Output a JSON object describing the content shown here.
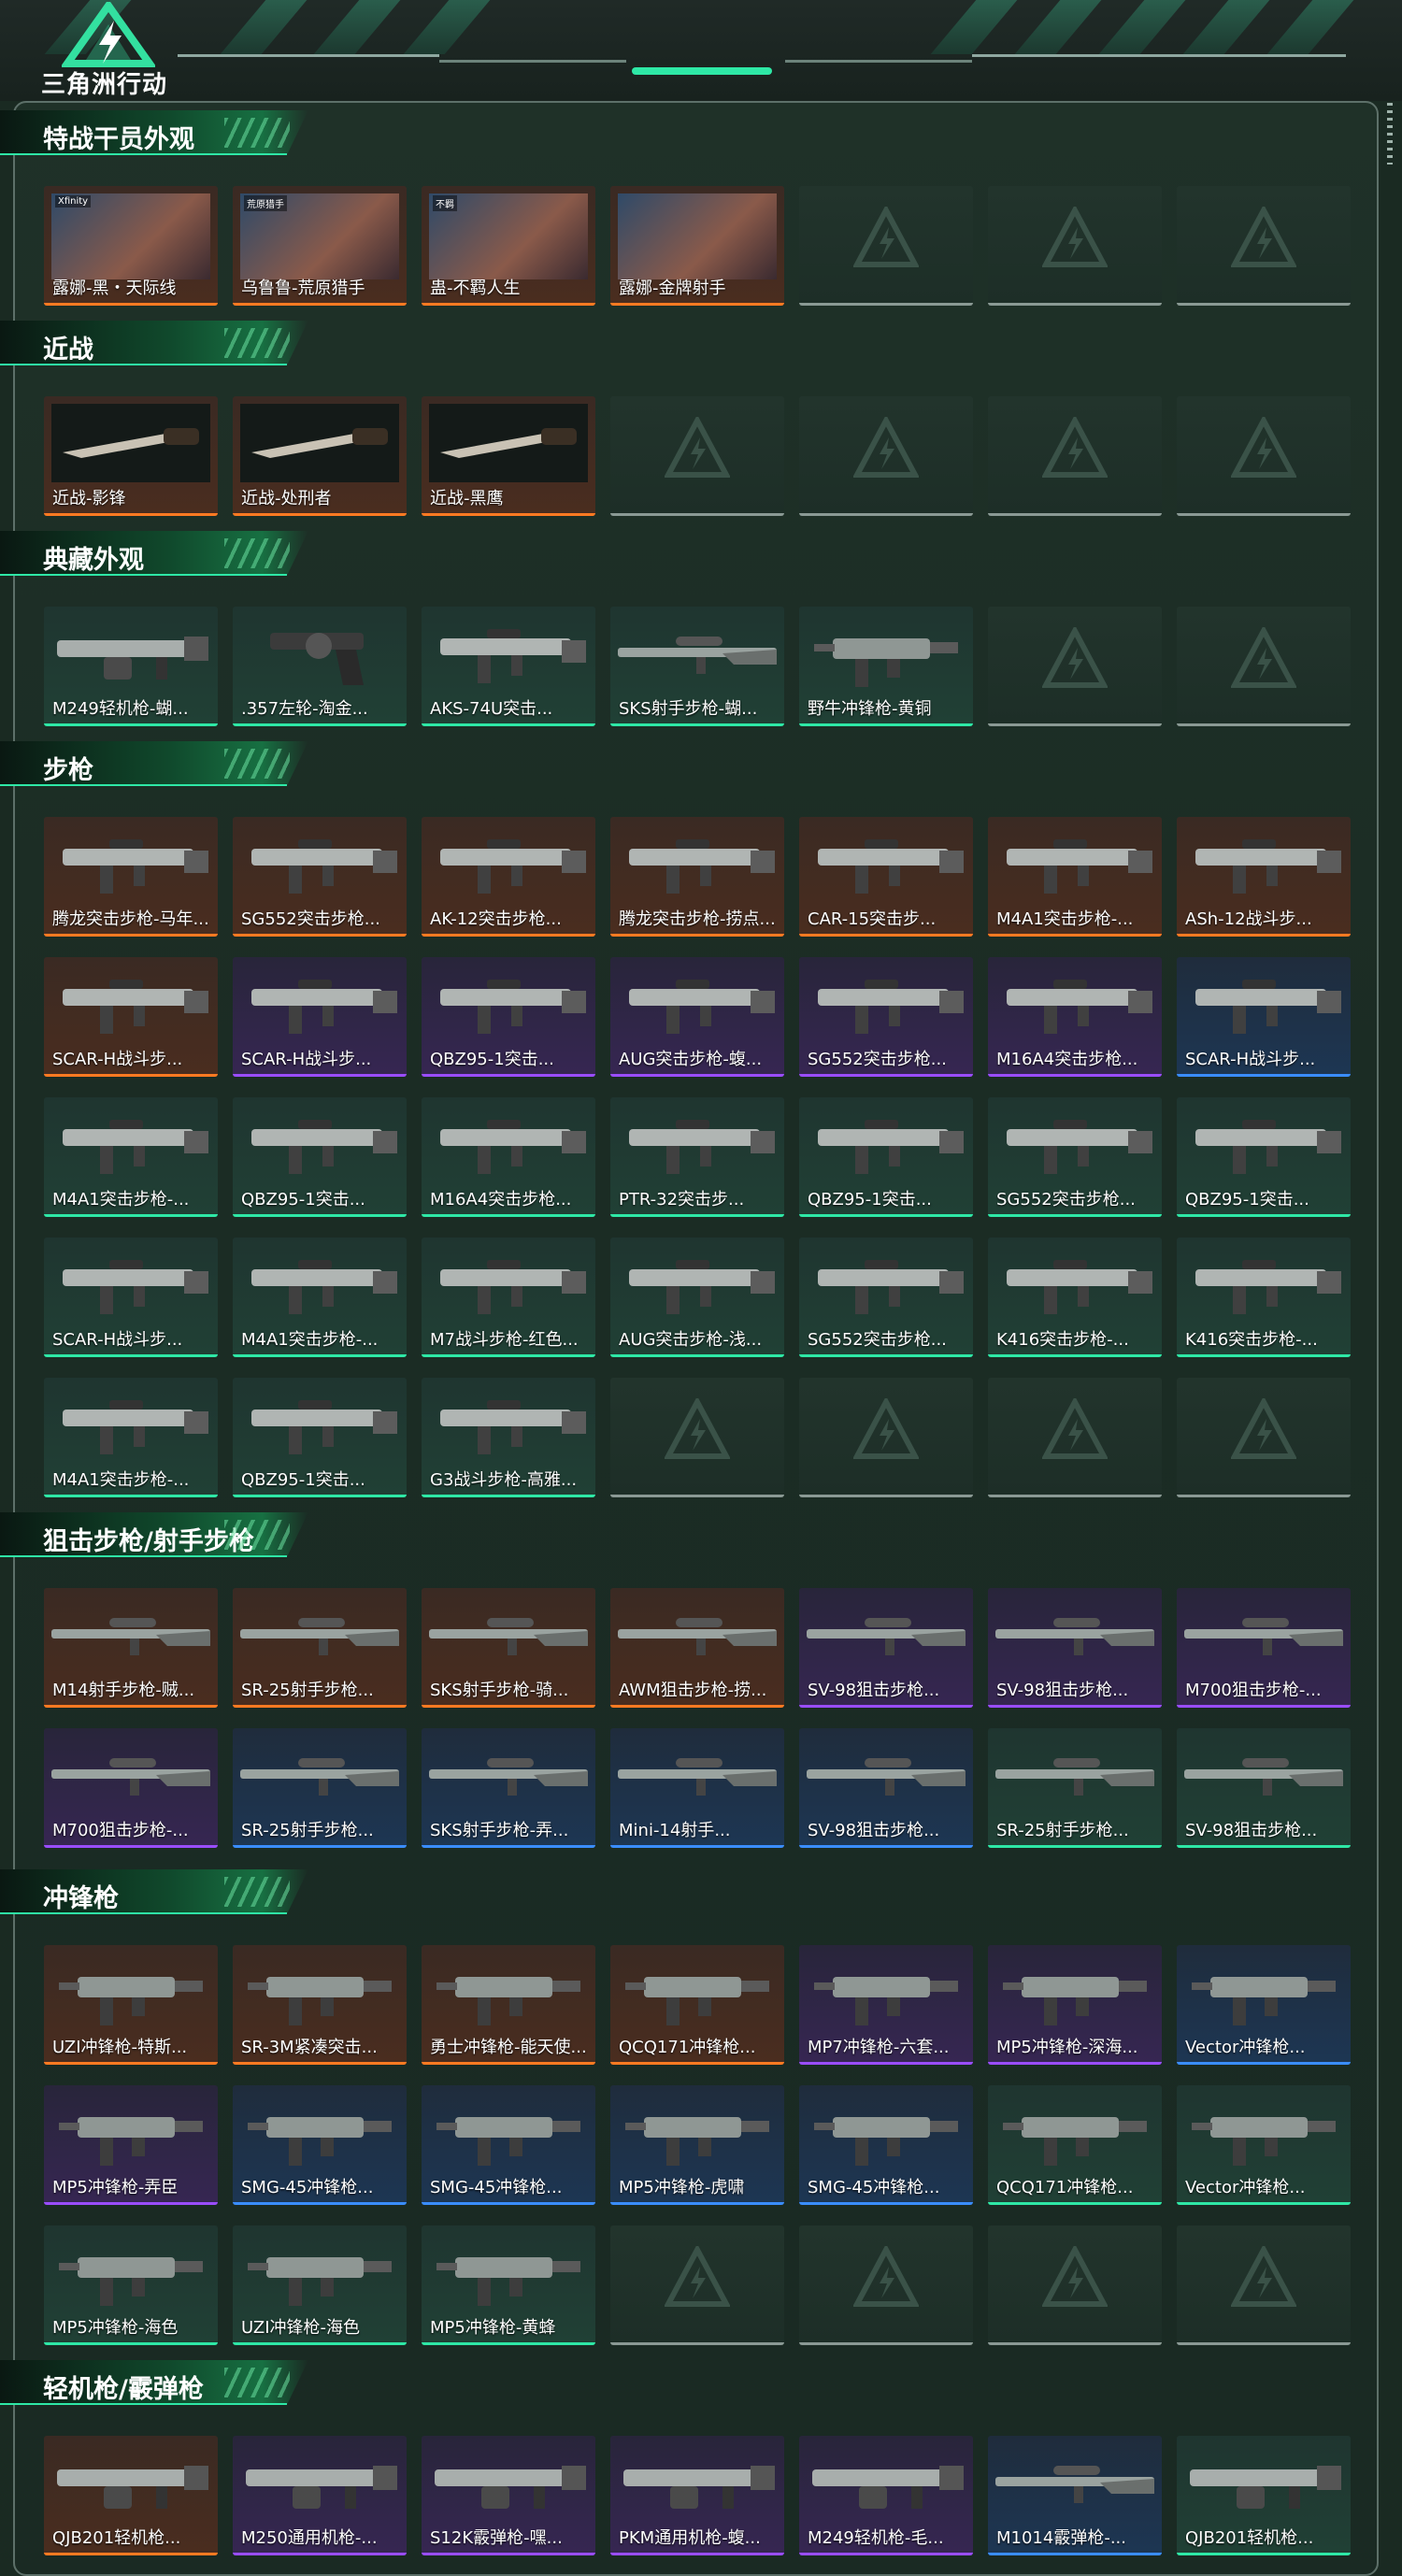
{
  "app": {
    "logo_text": "三角洲行动"
  },
  "colors": {
    "accent": "#2ee8a6",
    "quality_orange": "#ff7a22",
    "quality_purple": "#9a4dff",
    "quality_blue": "#3a8dff",
    "quality_green": "#2ee8a6",
    "empty_slot": "#8a9994"
  },
  "sections": [
    {
      "title": "特战干员外观",
      "items": [
        {
          "label": "露娜-黑・天际线",
          "quality": "orange",
          "kind": "portrait",
          "tag": "Xfinity"
        },
        {
          "label": "乌鲁鲁-荒原猎手",
          "quality": "orange",
          "kind": "portrait",
          "tag": "荒原猎手"
        },
        {
          "label": "蛊-不羁人生",
          "quality": "orange",
          "kind": "portrait",
          "tag": "不羁"
        },
        {
          "label": "露娜-金牌射手",
          "quality": "orange",
          "kind": "portrait",
          "tag": ""
        },
        {
          "label": "",
          "quality": "empty",
          "kind": "empty"
        },
        {
          "label": "",
          "quality": "empty",
          "kind": "empty"
        },
        {
          "label": "",
          "quality": "empty",
          "kind": "empty"
        }
      ]
    },
    {
      "title": "近战",
      "items": [
        {
          "label": "近战-影锋",
          "quality": "orange",
          "kind": "knife"
        },
        {
          "label": "近战-处刑者",
          "quality": "orange",
          "kind": "knife"
        },
        {
          "label": "近战-黑鹰",
          "quality": "orange",
          "kind": "knife"
        },
        {
          "label": "",
          "quality": "empty",
          "kind": "empty"
        },
        {
          "label": "",
          "quality": "empty",
          "kind": "empty"
        },
        {
          "label": "",
          "quality": "empty",
          "kind": "empty"
        },
        {
          "label": "",
          "quality": "empty",
          "kind": "empty"
        }
      ]
    },
    {
      "title": "典藏外观",
      "items": [
        {
          "label": "M249轻机枪-蝴...",
          "quality": "green",
          "kind": "lmg"
        },
        {
          "label": ".357左轮-淘金...",
          "quality": "green",
          "kind": "pistol"
        },
        {
          "label": "AKS-74U突击...",
          "quality": "green",
          "kind": "rifle"
        },
        {
          "label": "SKS射手步枪-蝴...",
          "quality": "green",
          "kind": "sniper"
        },
        {
          "label": "野牛冲锋枪-黄铜",
          "quality": "green",
          "kind": "smg"
        },
        {
          "label": "",
          "quality": "empty",
          "kind": "empty"
        },
        {
          "label": "",
          "quality": "empty",
          "kind": "empty"
        }
      ]
    },
    {
      "title": "步枪",
      "items": [
        {
          "label": "腾龙突击步枪-马年...",
          "quality": "orange",
          "kind": "rifle"
        },
        {
          "label": "SG552突击步枪...",
          "quality": "orange",
          "kind": "rifle"
        },
        {
          "label": "AK-12突击步枪...",
          "quality": "orange",
          "kind": "rifle"
        },
        {
          "label": "腾龙突击步枪-捞点...",
          "quality": "orange",
          "kind": "rifle"
        },
        {
          "label": "CAR-15突击步...",
          "quality": "orange",
          "kind": "rifle"
        },
        {
          "label": "M4A1突击步枪-...",
          "quality": "orange",
          "kind": "rifle"
        },
        {
          "label": "ASh-12战斗步...",
          "quality": "orange",
          "kind": "rifle"
        },
        {
          "label": "SCAR-H战斗步...",
          "quality": "orange",
          "kind": "rifle"
        },
        {
          "label": "SCAR-H战斗步...",
          "quality": "purple",
          "kind": "rifle"
        },
        {
          "label": "QBZ95-1突击...",
          "quality": "purple",
          "kind": "rifle"
        },
        {
          "label": "AUG突击步枪-蝮...",
          "quality": "purple",
          "kind": "rifle"
        },
        {
          "label": "SG552突击步枪...",
          "quality": "purple",
          "kind": "rifle"
        },
        {
          "label": "M16A4突击步枪...",
          "quality": "purple",
          "kind": "rifle"
        },
        {
          "label": "SCAR-H战斗步...",
          "quality": "blue",
          "kind": "rifle"
        },
        {
          "label": "M4A1突击步枪-...",
          "quality": "green",
          "kind": "rifle"
        },
        {
          "label": "QBZ95-1突击...",
          "quality": "green",
          "kind": "rifle"
        },
        {
          "label": "M16A4突击步枪...",
          "quality": "green",
          "kind": "rifle"
        },
        {
          "label": "PTR-32突击步...",
          "quality": "green",
          "kind": "rifle"
        },
        {
          "label": "QBZ95-1突击...",
          "quality": "green",
          "kind": "rifle"
        },
        {
          "label": "SG552突击步枪...",
          "quality": "green",
          "kind": "rifle"
        },
        {
          "label": "QBZ95-1突击...",
          "quality": "green",
          "kind": "rifle"
        },
        {
          "label": "SCAR-H战斗步...",
          "quality": "green",
          "kind": "rifle"
        },
        {
          "label": "M4A1突击步枪-...",
          "quality": "green",
          "kind": "rifle"
        },
        {
          "label": "M7战斗步枪-红色...",
          "quality": "green",
          "kind": "rifle"
        },
        {
          "label": "AUG突击步枪-浅...",
          "quality": "green",
          "kind": "rifle"
        },
        {
          "label": "SG552突击步枪...",
          "quality": "green",
          "kind": "rifle"
        },
        {
          "label": "K416突击步枪-...",
          "quality": "green",
          "kind": "rifle"
        },
        {
          "label": "K416突击步枪-...",
          "quality": "green",
          "kind": "rifle"
        },
        {
          "label": "M4A1突击步枪-...",
          "quality": "green",
          "kind": "rifle"
        },
        {
          "label": "QBZ95-1突击...",
          "quality": "green",
          "kind": "rifle"
        },
        {
          "label": "G3战斗步枪-高雅...",
          "quality": "green",
          "kind": "rifle"
        },
        {
          "label": "",
          "quality": "empty",
          "kind": "empty"
        },
        {
          "label": "",
          "quality": "empty",
          "kind": "empty"
        },
        {
          "label": "",
          "quality": "empty",
          "kind": "empty"
        },
        {
          "label": "",
          "quality": "empty",
          "kind": "empty"
        }
      ]
    },
    {
      "title": "狙击步枪/射手步枪",
      "items": [
        {
          "label": "M14射手步枪-贼...",
          "quality": "orange",
          "kind": "sniper"
        },
        {
          "label": "SR-25射手步枪...",
          "quality": "orange",
          "kind": "sniper"
        },
        {
          "label": "SKS射手步枪-骑...",
          "quality": "orange",
          "kind": "sniper"
        },
        {
          "label": "AWM狙击步枪-捞...",
          "quality": "orange",
          "kind": "sniper"
        },
        {
          "label": "SV-98狙击步枪...",
          "quality": "purple",
          "kind": "sniper"
        },
        {
          "label": "SV-98狙击步枪...",
          "quality": "purple",
          "kind": "sniper"
        },
        {
          "label": "M700狙击步枪-...",
          "quality": "purple",
          "kind": "sniper"
        },
        {
          "label": "M700狙击步枪-...",
          "quality": "purple",
          "kind": "sniper"
        },
        {
          "label": "SR-25射手步枪...",
          "quality": "blue",
          "kind": "sniper"
        },
        {
          "label": "SKS射手步枪-弄...",
          "quality": "blue",
          "kind": "sniper"
        },
        {
          "label": "Mini-14射手...",
          "quality": "blue",
          "kind": "sniper"
        },
        {
          "label": "SV-98狙击步枪...",
          "quality": "blue",
          "kind": "sniper"
        },
        {
          "label": "SR-25射手步枪...",
          "quality": "green",
          "kind": "sniper"
        },
        {
          "label": "SV-98狙击步枪...",
          "quality": "green",
          "kind": "sniper"
        }
      ]
    },
    {
      "title": "冲锋枪",
      "items": [
        {
          "label": "UZI冲锋枪-特斯...",
          "quality": "orange",
          "kind": "smg"
        },
        {
          "label": "SR-3M紧凑突击...",
          "quality": "orange",
          "kind": "smg"
        },
        {
          "label": "勇士冲锋枪-能天使...",
          "quality": "orange",
          "kind": "smg"
        },
        {
          "label": "QCQ171冲锋枪...",
          "quality": "orange",
          "kind": "smg"
        },
        {
          "label": "MP7冲锋枪-六套...",
          "quality": "purple",
          "kind": "smg"
        },
        {
          "label": "MP5冲锋枪-深海...",
          "quality": "purple",
          "kind": "smg"
        },
        {
          "label": "Vector冲锋枪...",
          "quality": "blue",
          "kind": "smg"
        },
        {
          "label": "MP5冲锋枪-弄臣",
          "quality": "purple",
          "kind": "smg"
        },
        {
          "label": "SMG-45冲锋枪...",
          "quality": "blue",
          "kind": "smg"
        },
        {
          "label": "SMG-45冲锋枪...",
          "quality": "blue",
          "kind": "smg"
        },
        {
          "label": "MP5冲锋枪-虎啸",
          "quality": "blue",
          "kind": "smg"
        },
        {
          "label": "SMG-45冲锋枪...",
          "quality": "blue",
          "kind": "smg"
        },
        {
          "label": "QCQ171冲锋枪...",
          "quality": "green",
          "kind": "smg"
        },
        {
          "label": "Vector冲锋枪...",
          "quality": "green",
          "kind": "smg"
        },
        {
          "label": "MP5冲锋枪-海色",
          "quality": "green",
          "kind": "smg"
        },
        {
          "label": "UZI冲锋枪-海色",
          "quality": "green",
          "kind": "smg"
        },
        {
          "label": "MP5冲锋枪-黄蜂",
          "quality": "green",
          "kind": "smg"
        },
        {
          "label": "",
          "quality": "empty",
          "kind": "empty"
        },
        {
          "label": "",
          "quality": "empty",
          "kind": "empty"
        },
        {
          "label": "",
          "quality": "empty",
          "kind": "empty"
        },
        {
          "label": "",
          "quality": "empty",
          "kind": "empty"
        }
      ]
    },
    {
      "title": "轻机枪/霰弹枪",
      "items": [
        {
          "label": "QJB201轻机枪...",
          "quality": "orange",
          "kind": "lmg"
        },
        {
          "label": "M250通用机枪-...",
          "quality": "purple",
          "kind": "lmg"
        },
        {
          "label": "S12K霰弹枪-嘿...",
          "quality": "purple",
          "kind": "lmg"
        },
        {
          "label": "PKM通用机枪-蝮...",
          "quality": "purple",
          "kind": "lmg"
        },
        {
          "label": "M249轻机枪-毛...",
          "quality": "purple",
          "kind": "lmg"
        },
        {
          "label": "M1014霰弹枪-...",
          "quality": "blue",
          "kind": "sniper"
        },
        {
          "label": "QJB201轻机枪...",
          "quality": "green",
          "kind": "lmg"
        }
      ]
    }
  ]
}
